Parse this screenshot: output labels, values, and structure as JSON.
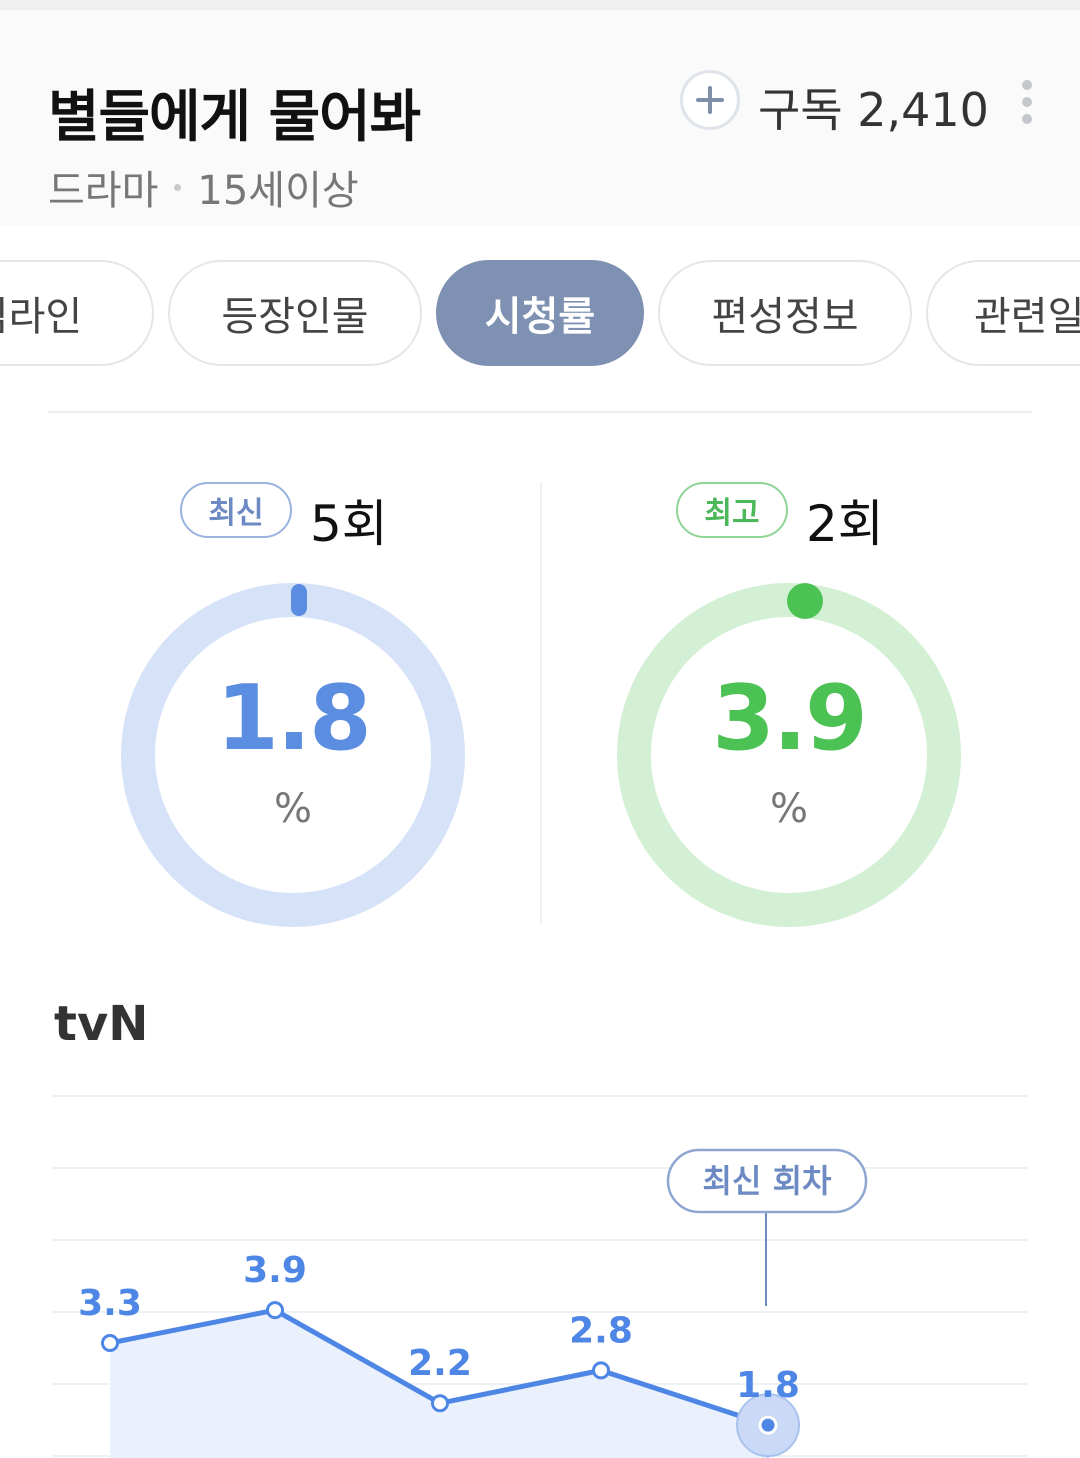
{
  "program": {
    "title": "별들에게 물어봐",
    "genre": "드라마",
    "rating": "15세이상",
    "subscribe_label": "구독 2,410"
  },
  "tabs": [
    {
      "label": "임라인",
      "active": false
    },
    {
      "label": "등장인물",
      "active": false
    },
    {
      "label": "시청률",
      "active": true
    },
    {
      "label": "편성정보",
      "active": false
    },
    {
      "label": "관련일",
      "active": false
    }
  ],
  "ratings": {
    "latest": {
      "badge": "최신",
      "episode": "5회",
      "value": "1.8",
      "unit": "%",
      "color": "#5b8de0",
      "track": "#d5e2f8"
    },
    "best": {
      "badge": "최고",
      "episode": "2회",
      "value": "3.9",
      "unit": "%",
      "color": "#4cc255",
      "track": "#d3f0d5"
    }
  },
  "channel": "tvN",
  "chart_data": {
    "type": "line",
    "x": [
      1,
      2,
      3,
      4,
      5
    ],
    "series": [
      {
        "values": [
          3.3,
          3.9,
          2.2,
          2.8,
          1.8
        ]
      }
    ],
    "data_labels": [
      "3.3",
      "3.9",
      "2.2",
      "2.8",
      "1.8"
    ],
    "annotation": "최신 회차",
    "highlight_index": 4,
    "color": "#4d86e4",
    "grid": true
  }
}
